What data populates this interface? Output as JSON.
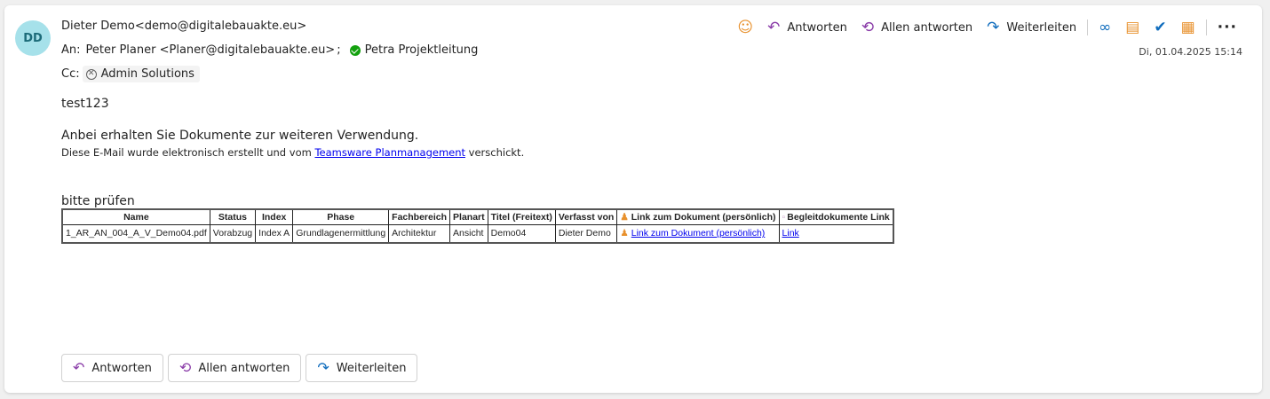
{
  "header": {
    "avatar_initials": "DD",
    "sender": "Dieter Demo<demo@digitalebauakte.eu>",
    "to_label": "An:",
    "to_recipient_1": "Peter Planer <Planer@digitalebauakte.eu>",
    "to_separator": ";",
    "to_recipient_2": "Petra Projektleitung",
    "cc_label": "Cc:",
    "cc_recipient": "Admin Solutions",
    "date": "Di, 01.04.2025 15:14"
  },
  "toolbar": {
    "reply": "Antworten",
    "reply_all": "Allen antworten",
    "forward": "Weiterleiten"
  },
  "body": {
    "line1": "test123",
    "line2": "Anbei erhalten Sie Dokumente zur weiteren Verwendung.",
    "line3_prefix": "Diese E-Mail wurde elektronisch erstellt und vom ",
    "line3_link": "Teamsware Planmanagement",
    "line3_suffix": " verschickt.",
    "line4": "bitte prüfen"
  },
  "table": {
    "headers": [
      "Name",
      "Status",
      "Index",
      "Phase",
      "Fachbereich",
      "Planart",
      "Titel (Freitext)",
      "Verfasst von",
      "Link zum Dokument (persönlich)",
      "Begleitdokumente Link"
    ],
    "row": {
      "name": "1_AR_AN_004_A_V_Demo04.pdf",
      "status": "Vorabzug",
      "index": "Index A",
      "phase": "Grundlagenermittlung",
      "fachbereich": "Architektur",
      "planart": "Ansicht",
      "titel": "Demo04",
      "verfasst": "Dieter Demo",
      "link_doc": "Link zum Dokument (persönlich)",
      "link_begleit": "Link"
    }
  },
  "footer": {
    "reply": "Antworten",
    "reply_all": "Allen antworten",
    "forward": "Weiterleiten"
  },
  "colors": {
    "accent_purple": "#8a3ca8",
    "accent_blue": "#0f6cbd",
    "avatar_bg": "#a6e1ea",
    "presence_green": "#13a10e"
  }
}
